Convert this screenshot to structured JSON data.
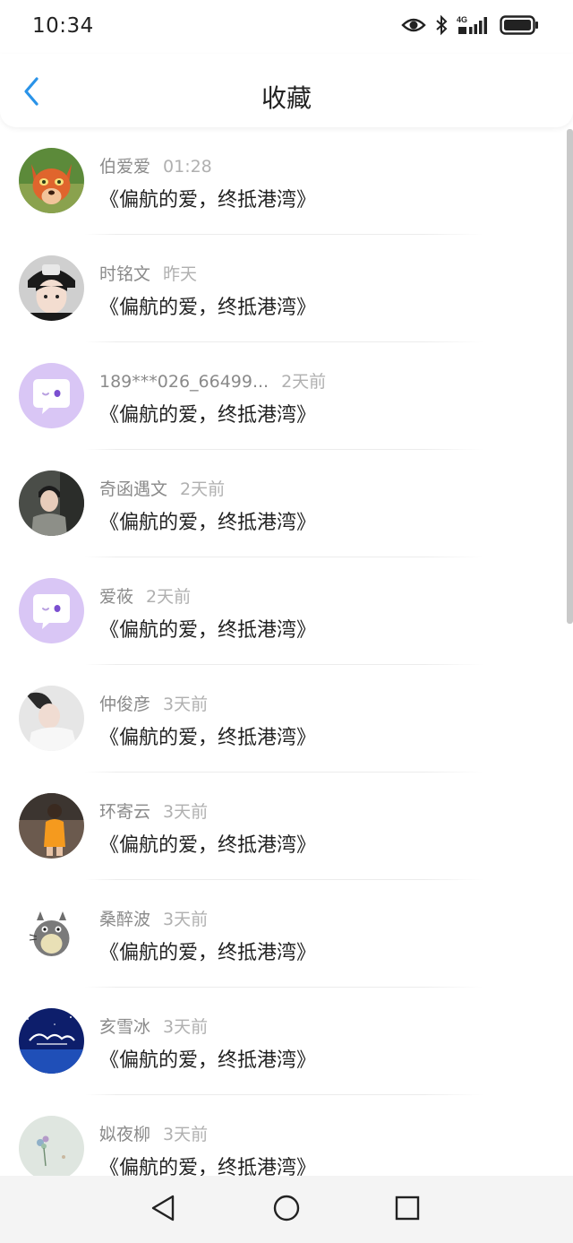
{
  "status_bar": {
    "time": "10:34",
    "network": "4G",
    "icons": [
      "eye-icon",
      "bluetooth-icon",
      "signal-icon",
      "battery-icon"
    ]
  },
  "header": {
    "title": "收藏",
    "back_icon": "chevron-left-icon",
    "accent_color": "#2a93e8"
  },
  "favorites": [
    {
      "name": "伯爱爱",
      "time": "01:28",
      "content": "《偏航的爱，终抵港湾》",
      "avatar": "fox-cartoon"
    },
    {
      "name": "时铭文",
      "time": "昨天",
      "content": "《偏航的爱，终抵港湾》",
      "avatar": "person-cap"
    },
    {
      "name": "189***026_66499...",
      "time": "2天前",
      "content": "《偏航的爱，终抵港湾》",
      "avatar": "default-chat-bubble"
    },
    {
      "name": "奇函遇文",
      "time": "2天前",
      "content": "《偏航的爱，终抵港湾》",
      "avatar": "person-photo"
    },
    {
      "name": "爱莜",
      "time": "2天前",
      "content": "《偏航的爱，终抵港湾》",
      "avatar": "default-chat-bubble"
    },
    {
      "name": "仲俊彦",
      "time": "3天前",
      "content": "《偏航的爱，终抵港湾》",
      "avatar": "person-photo-light"
    },
    {
      "name": "环寄云",
      "time": "3天前",
      "content": "《偏航的爱，终抵港湾》",
      "avatar": "child-orange-shirt"
    },
    {
      "name": "桑醉波",
      "time": "3天前",
      "content": "《偏航的爱，终抵港湾》",
      "avatar": "totoro-cartoon"
    },
    {
      "name": "亥雪冰",
      "time": "3天前",
      "content": "《偏航的爱，终抵港湾》",
      "avatar": "blue-night-sky"
    },
    {
      "name": "姒夜柳",
      "time": "3天前",
      "content": "《偏航的爱，终抵港湾》",
      "avatar": "flower-painting"
    }
  ],
  "nav_bar": {
    "back": "triangle-back-icon",
    "home": "circle-home-icon",
    "recents": "square-recents-icon"
  }
}
